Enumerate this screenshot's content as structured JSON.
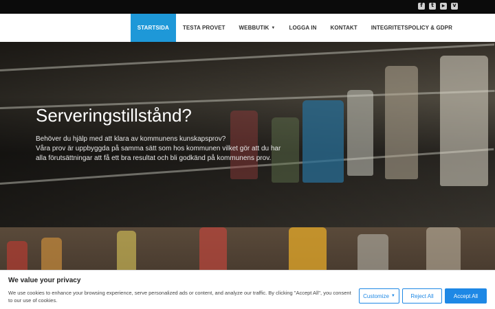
{
  "social": {
    "icons": [
      "facebook-icon",
      "twitter-icon",
      "youtube-icon",
      "vimeo-icon"
    ]
  },
  "nav": {
    "items": [
      {
        "label": "STARTSIDA",
        "active": true
      },
      {
        "label": "TESTA PROVET"
      },
      {
        "label": "WEBBUTIK",
        "has_dropdown": true
      },
      {
        "label": "LOGGA IN"
      },
      {
        "label": "KONTAKT"
      },
      {
        "label": "INTEGRITETSPOLICY & GDPR"
      }
    ],
    "dropdown_icon": "chevron-down-icon"
  },
  "hero": {
    "title": "Serveringstillstånd?",
    "lines": [
      "Behöver du hjälp med att klara av kommunens kunskapsprov?",
      "Våra prov är uppbyggda på samma sätt som hos kommunen vilket gör att du har",
      "alla förutsättningar att få ett bra resultat och bli godkänd på kommunens prov."
    ]
  },
  "cookie": {
    "title": "We value your privacy",
    "text": "We use cookies to enhance your browsing experience, serve personalized ads or content, and analyze our traffic. By clicking \"Accept All\", you consent to our use of cookies.",
    "customize_label": "Customize",
    "reject_label": "Reject All",
    "accept_label": "Accept All"
  },
  "colors": {
    "accent": "#1e98d8",
    "cookie_button": "#1e88e5",
    "topbar": "#0b0b0b"
  }
}
